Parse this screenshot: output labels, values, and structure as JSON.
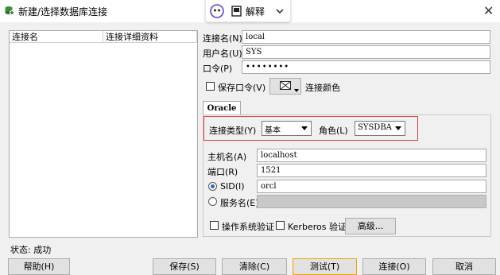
{
  "window": {
    "title": "新建/选择数据库连接",
    "close_glyph": "✕"
  },
  "toolbar": {
    "translate_label": "解释"
  },
  "list": {
    "columns": [
      "连接名",
      "连接详细资料"
    ]
  },
  "form": {
    "conn_name_label": "连接名(N)",
    "conn_name_value": "local",
    "user_label": "用户名(U)",
    "user_value": "SYS",
    "password_label": "口令(P)",
    "password_value": "••••••••",
    "save_password_label": "保存口令(V)",
    "color_label": "连接颜色"
  },
  "tabs": [
    {
      "label": "Oracle"
    }
  ],
  "oracle": {
    "conn_type_label": "连接类型(Y)",
    "conn_type_value": "基本",
    "role_label": "角色(L)",
    "role_value": "SYSDBA",
    "host_label": "主机名(A)",
    "host_value": "localhost",
    "port_label": "端口(R)",
    "port_value": "1521",
    "sid_label": "SID(I)",
    "sid_value": "orcl",
    "sid_selected": true,
    "service_label": "服务名(E)",
    "os_auth_label": "操作系统验证",
    "kerberos_label": "Kerberos 验证",
    "advanced_label": "高级..."
  },
  "status": {
    "text": "状态: 成功"
  },
  "buttons": {
    "help": "帮助(H)",
    "save": "保存(S)",
    "clear": "清除(C)",
    "test": "测试(T)",
    "connect": "连接(O)",
    "cancel": "取消"
  },
  "colors": {
    "accent_border": "#e03a3a",
    "focus_border": "#f0a500"
  }
}
